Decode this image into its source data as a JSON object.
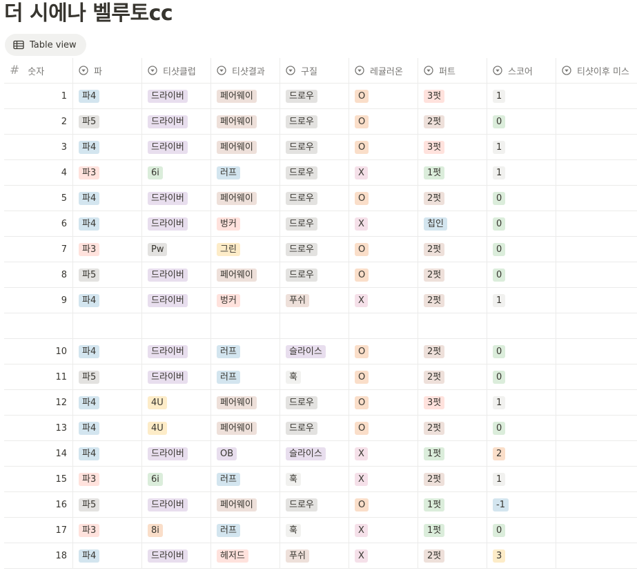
{
  "title": "더 시에나 벨루토cc",
  "view": {
    "label": "Table view",
    "icon": "table-icon"
  },
  "columns": [
    {
      "label": "숫자",
      "icon": "hash-icon"
    },
    {
      "label": "파",
      "icon": "select-icon"
    },
    {
      "label": "티샷클럽",
      "icon": "select-icon"
    },
    {
      "label": "티샷결과",
      "icon": "select-icon"
    },
    {
      "label": "구질",
      "icon": "select-icon"
    },
    {
      "label": "레귤러온",
      "icon": "select-icon"
    },
    {
      "label": "퍼트",
      "icon": "select-icon"
    },
    {
      "label": "스코어",
      "icon": "select-icon"
    },
    {
      "label": "티샷이후 미스",
      "icon": "select-icon"
    }
  ],
  "colors": {
    "blue": "#d3e5ef",
    "gray": "#e3e2e0",
    "purple": "#e8deee",
    "brown": "#eee0da",
    "red": "#ffe2dd",
    "green": "#dbeddb",
    "yellow": "#fdecc8",
    "pink": "#f5e0e9",
    "orange": "#fadec9",
    "lightgray": "#f1f1ef"
  },
  "rows": [
    {
      "num": "1",
      "cells": [
        [
          "파4",
          "blue"
        ],
        [
          "드라이버",
          "purple"
        ],
        [
          "페어웨이",
          "brown"
        ],
        [
          "드로우",
          "gray"
        ],
        [
          "O",
          "orange"
        ],
        [
          "3펏",
          "red"
        ],
        [
          "1",
          "lightgray"
        ]
      ]
    },
    {
      "num": "2",
      "cells": [
        [
          "파5",
          "gray"
        ],
        [
          "드라이버",
          "purple"
        ],
        [
          "페어웨이",
          "brown"
        ],
        [
          "드로우",
          "gray"
        ],
        [
          "O",
          "orange"
        ],
        [
          "2펏",
          "brown"
        ],
        [
          "0",
          "green"
        ]
      ]
    },
    {
      "num": "3",
      "cells": [
        [
          "파4",
          "blue"
        ],
        [
          "드라이버",
          "purple"
        ],
        [
          "페어웨이",
          "brown"
        ],
        [
          "드로우",
          "gray"
        ],
        [
          "O",
          "orange"
        ],
        [
          "3펏",
          "red"
        ],
        [
          "1",
          "lightgray"
        ]
      ]
    },
    {
      "num": "4",
      "cells": [
        [
          "파3",
          "red"
        ],
        [
          "6i",
          "green"
        ],
        [
          "러프",
          "blue"
        ],
        [
          "드로우",
          "gray"
        ],
        [
          "X",
          "pink"
        ],
        [
          "1펏",
          "green"
        ],
        [
          "1",
          "lightgray"
        ]
      ]
    },
    {
      "num": "5",
      "cells": [
        [
          "파4",
          "blue"
        ],
        [
          "드라이버",
          "purple"
        ],
        [
          "페어웨이",
          "brown"
        ],
        [
          "드로우",
          "gray"
        ],
        [
          "O",
          "orange"
        ],
        [
          "2펏",
          "brown"
        ],
        [
          "0",
          "green"
        ]
      ]
    },
    {
      "num": "6",
      "cells": [
        [
          "파4",
          "blue"
        ],
        [
          "드라이버",
          "purple"
        ],
        [
          "벙커",
          "red"
        ],
        [
          "드로우",
          "gray"
        ],
        [
          "X",
          "pink"
        ],
        [
          "칩인",
          "blue"
        ],
        [
          "0",
          "green"
        ]
      ]
    },
    {
      "num": "7",
      "cells": [
        [
          "파3",
          "red"
        ],
        [
          "Pw",
          "gray"
        ],
        [
          "그린",
          "yellow"
        ],
        [
          "드로우",
          "gray"
        ],
        [
          "O",
          "orange"
        ],
        [
          "2펏",
          "brown"
        ],
        [
          "0",
          "green"
        ]
      ]
    },
    {
      "num": "8",
      "cells": [
        [
          "파5",
          "gray"
        ],
        [
          "드라이버",
          "purple"
        ],
        [
          "페어웨이",
          "brown"
        ],
        [
          "드로우",
          "gray"
        ],
        [
          "O",
          "orange"
        ],
        [
          "2펏",
          "brown"
        ],
        [
          "0",
          "green"
        ]
      ]
    },
    {
      "num": "9",
      "cells": [
        [
          "파4",
          "blue"
        ],
        [
          "드라이버",
          "purple"
        ],
        [
          "벙커",
          "red"
        ],
        [
          "푸쉬",
          "brown"
        ],
        [
          "X",
          "pink"
        ],
        [
          "2펏",
          "brown"
        ],
        [
          "1",
          "lightgray"
        ]
      ]
    },
    {
      "num": "",
      "cells": []
    },
    {
      "num": "10",
      "cells": [
        [
          "파4",
          "blue"
        ],
        [
          "드라이버",
          "purple"
        ],
        [
          "러프",
          "blue"
        ],
        [
          "슬라이스",
          "purple"
        ],
        [
          "O",
          "orange"
        ],
        [
          "2펏",
          "brown"
        ],
        [
          "0",
          "green"
        ]
      ]
    },
    {
      "num": "11",
      "cells": [
        [
          "파5",
          "gray"
        ],
        [
          "드라이버",
          "purple"
        ],
        [
          "러프",
          "blue"
        ],
        [
          "훅",
          "lightgray"
        ],
        [
          "O",
          "orange"
        ],
        [
          "2펏",
          "brown"
        ],
        [
          "0",
          "green"
        ]
      ]
    },
    {
      "num": "12",
      "cells": [
        [
          "파4",
          "blue"
        ],
        [
          "4U",
          "yellow"
        ],
        [
          "페어웨이",
          "brown"
        ],
        [
          "드로우",
          "gray"
        ],
        [
          "O",
          "orange"
        ],
        [
          "3펏",
          "red"
        ],
        [
          "1",
          "lightgray"
        ]
      ]
    },
    {
      "num": "13",
      "cells": [
        [
          "파4",
          "blue"
        ],
        [
          "4U",
          "yellow"
        ],
        [
          "페어웨이",
          "brown"
        ],
        [
          "드로우",
          "gray"
        ],
        [
          "O",
          "orange"
        ],
        [
          "2펏",
          "brown"
        ],
        [
          "0",
          "green"
        ]
      ]
    },
    {
      "num": "14",
      "cells": [
        [
          "파4",
          "blue"
        ],
        [
          "드라이버",
          "purple"
        ],
        [
          "OB",
          "purple"
        ],
        [
          "슬라이스",
          "purple"
        ],
        [
          "X",
          "pink"
        ],
        [
          "1펏",
          "green"
        ],
        [
          "2",
          "orange"
        ]
      ]
    },
    {
      "num": "15",
      "cells": [
        [
          "파3",
          "red"
        ],
        [
          "6i",
          "green"
        ],
        [
          "러프",
          "blue"
        ],
        [
          "훅",
          "lightgray"
        ],
        [
          "X",
          "pink"
        ],
        [
          "2펏",
          "brown"
        ],
        [
          "1",
          "lightgray"
        ]
      ]
    },
    {
      "num": "16",
      "cells": [
        [
          "파5",
          "gray"
        ],
        [
          "드라이버",
          "purple"
        ],
        [
          "페어웨이",
          "brown"
        ],
        [
          "드로우",
          "gray"
        ],
        [
          "O",
          "orange"
        ],
        [
          "1펏",
          "green"
        ],
        [
          "-1",
          "blue"
        ]
      ]
    },
    {
      "num": "17",
      "cells": [
        [
          "파3",
          "red"
        ],
        [
          "8i",
          "orange"
        ],
        [
          "러프",
          "blue"
        ],
        [
          "훅",
          "lightgray"
        ],
        [
          "X",
          "pink"
        ],
        [
          "1펏",
          "green"
        ],
        [
          "0",
          "green"
        ]
      ]
    },
    {
      "num": "18",
      "cells": [
        [
          "파4",
          "blue"
        ],
        [
          "드라이버",
          "purple"
        ],
        [
          "헤저드",
          "red"
        ],
        [
          "푸쉬",
          "brown"
        ],
        [
          "X",
          "pink"
        ],
        [
          "2펏",
          "brown"
        ],
        [
          "3",
          "yellow"
        ]
      ]
    }
  ]
}
